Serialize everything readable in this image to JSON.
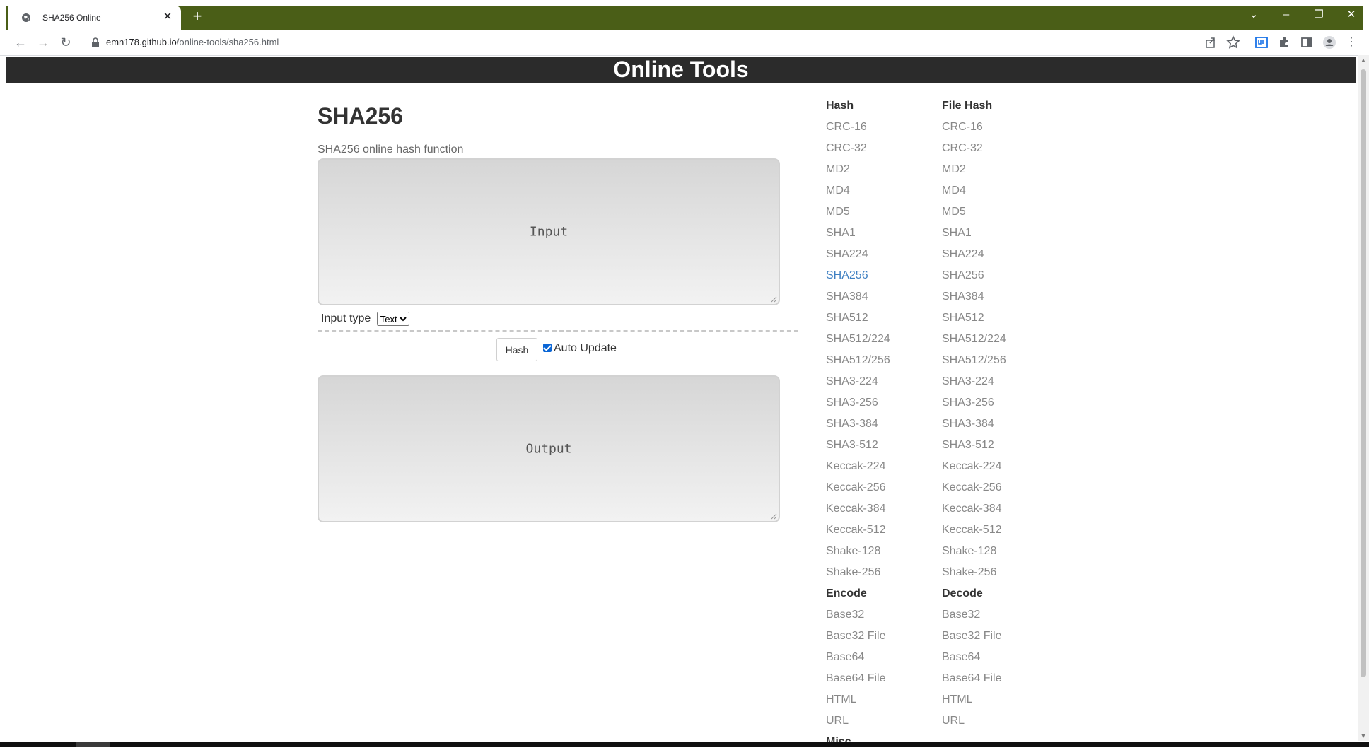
{
  "browser": {
    "tab_title": "SHA256 Online",
    "url_host": "emn178.github.io",
    "url_path": "/online-tools/sha256.html"
  },
  "page": {
    "site_title": "Online Tools",
    "heading": "SHA256",
    "description": "SHA256 online hash function",
    "input_placeholder": "Input",
    "output_placeholder": "Output",
    "input_type_label": "Input type",
    "input_type_selected": "Text",
    "hash_button": "Hash",
    "auto_update_label": "Auto Update",
    "auto_update_checked": true
  },
  "sidebar": {
    "col1": {
      "hash_heading": "Hash",
      "hash_items": [
        "CRC-16",
        "CRC-32",
        "MD2",
        "MD4",
        "MD5",
        "SHA1",
        "SHA224",
        "SHA256",
        "SHA384",
        "SHA512",
        "SHA512/224",
        "SHA512/256",
        "SHA3-224",
        "SHA3-256",
        "SHA3-384",
        "SHA3-512",
        "Keccak-224",
        "Keccak-256",
        "Keccak-384",
        "Keccak-512",
        "Shake-128",
        "Shake-256"
      ],
      "active_item": "SHA256",
      "encode_heading": "Encode",
      "encode_items": [
        "Base32",
        "Base32 File",
        "Base64",
        "Base64 File",
        "HTML",
        "URL"
      ],
      "misc_heading": "Misc"
    },
    "col2": {
      "file_hash_heading": "File Hash",
      "file_hash_items": [
        "CRC-16",
        "CRC-32",
        "MD2",
        "MD4",
        "MD5",
        "SHA1",
        "SHA224",
        "SHA256",
        "SHA384",
        "SHA512",
        "SHA512/224",
        "SHA512/256",
        "SHA3-224",
        "SHA3-256",
        "SHA3-384",
        "SHA3-512",
        "Keccak-224",
        "Keccak-256",
        "Keccak-384",
        "Keccak-512",
        "Shake-128",
        "Shake-256"
      ],
      "decode_heading": "Decode",
      "decode_items": [
        "Base32",
        "Base32 File",
        "Base64",
        "Base64 File",
        "HTML",
        "URL"
      ]
    }
  },
  "colors": {
    "tabstrip": "#4a5e17",
    "header_bg": "#2b2b2b",
    "link_gray": "#888888",
    "link_active": "#3d7fc2"
  }
}
